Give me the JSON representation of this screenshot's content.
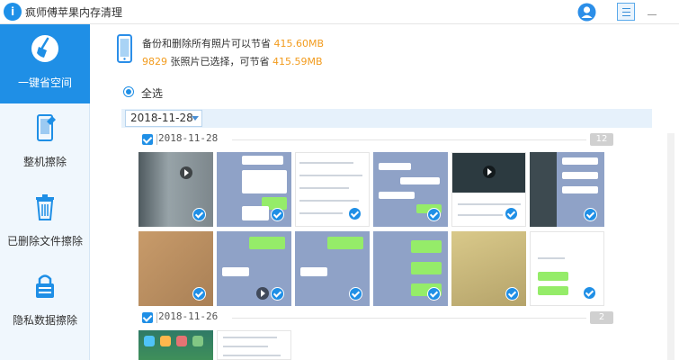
{
  "app": {
    "logo_glyph": "i",
    "title": "疯师傅苹果内存清理"
  },
  "sidebar": {
    "items": [
      {
        "label": "一键省空间",
        "icon": "broom-icon",
        "active": true
      },
      {
        "label": "整机擦除",
        "icon": "phone-erase-icon",
        "active": false
      },
      {
        "label": "已删除文件擦除",
        "icon": "trash-icon",
        "active": false
      },
      {
        "label": "隐私数据擦除",
        "icon": "lock-icon",
        "active": false
      }
    ]
  },
  "info": {
    "line1_prefix": "备份和删除所有照片可以节省",
    "line1_size": "415.60MB",
    "line2_count": "9829",
    "line2_mid": "张照片已选择，可节省",
    "line2_size": "415.59MB"
  },
  "select_all_label": "全选",
  "date_filter": "2018-11-28",
  "groups": [
    {
      "date": "2018-11-28",
      "count": "12"
    },
    {
      "date": "2018-11-26",
      "count": "2"
    }
  ],
  "colors": {
    "accent": "#1f8fe6",
    "highlight": "#f29b1d"
  }
}
